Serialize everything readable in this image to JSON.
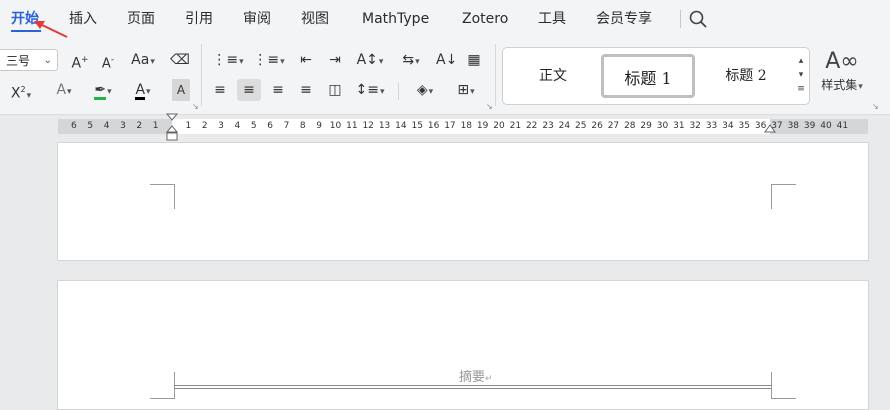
{
  "tabs": [
    {
      "label": "开始",
      "active": true
    },
    {
      "label": "插入"
    },
    {
      "label": "页面"
    },
    {
      "label": "引用"
    },
    {
      "label": "审阅"
    },
    {
      "label": "视图"
    },
    {
      "label": "MathType"
    },
    {
      "label": "Zotero"
    },
    {
      "label": "工具"
    },
    {
      "label": "会员专享"
    }
  ],
  "font_size_value": "三号",
  "styles": {
    "items": [
      "正文",
      "标题  1",
      "标题  2"
    ],
    "selected": "标题  1",
    "style_set_label": "样式集"
  },
  "ruler": {
    "left_numbers": [
      "6",
      "5",
      "4",
      "3",
      "2",
      "1"
    ],
    "right_numbers": [
      "1",
      "2",
      "3",
      "4",
      "5",
      "6",
      "7",
      "8",
      "9",
      "10",
      "11",
      "12",
      "13",
      "14",
      "15",
      "16",
      "17",
      "18",
      "19",
      "20",
      "21",
      "22",
      "23",
      "24",
      "25",
      "26",
      "27",
      "28",
      "29",
      "30",
      "31",
      "32",
      "33",
      "34",
      "35",
      "36",
      "37",
      "38",
      "39",
      "40",
      "41"
    ]
  },
  "document": {
    "header_text": "摘要"
  },
  "colors": {
    "accent": "#2b62d9",
    "highlight": "#22b14c",
    "font_color": "#000000",
    "annotation_arrow": "#e53935"
  }
}
